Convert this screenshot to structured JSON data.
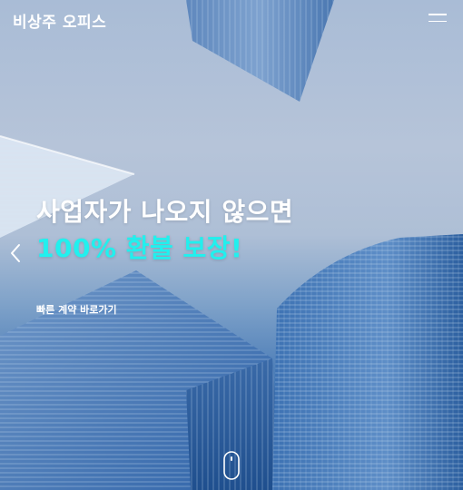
{
  "header": {
    "logo": "비상주 오피스",
    "menu_icon": "hamburger-menu-icon"
  },
  "hero": {
    "headline": "사업자가 나오지 않으면",
    "subheadline": "100% 환불 보장!",
    "quick_link": "빠른 계약 바로가기",
    "prev_icon": "chevron-left-icon",
    "scroll_icon": "mouse-scroll-icon"
  },
  "colors": {
    "accent": "#21f0ee",
    "text": "#ffffff",
    "sky": "#b6c4d9",
    "building": "#3f74b3"
  }
}
